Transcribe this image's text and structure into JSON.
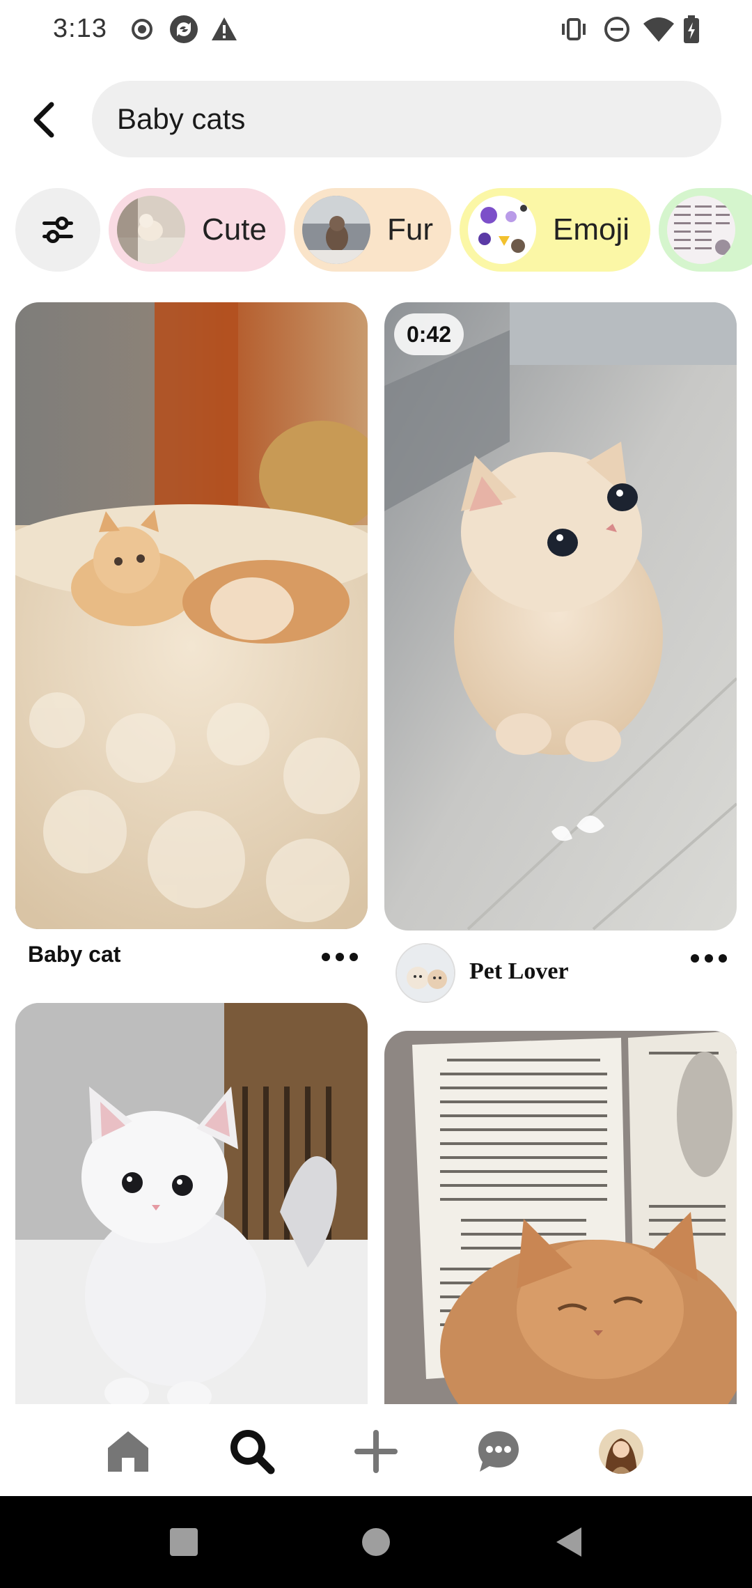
{
  "status_bar": {
    "time": "3:13"
  },
  "search": {
    "query": "Baby cats"
  },
  "chips": [
    {
      "label": "Cute",
      "color": "#f9dbe3"
    },
    {
      "label": "Fur",
      "color": "#fae4c9"
    },
    {
      "label": "Emoji",
      "color": "#fbf7a6"
    },
    {
      "label": "",
      "color": "#d5f5cd"
    }
  ],
  "pins": [
    {
      "title": "Baby cat",
      "icon": "kitten-on-blanket-image"
    },
    {
      "video_duration": "0:42",
      "author": "Pet Lover",
      "icon": "kitten-looking-up-image"
    },
    {
      "icon": "white-kitten-image"
    },
    {
      "icon": "kitten-with-book-image"
    }
  ],
  "bottom_nav": {
    "items": [
      "home-icon",
      "search-icon",
      "add-icon",
      "messages-icon",
      "profile-avatar"
    ],
    "active": "search-icon"
  },
  "colors": {
    "search_bg": "#efefef",
    "text_primary": "#111111"
  }
}
